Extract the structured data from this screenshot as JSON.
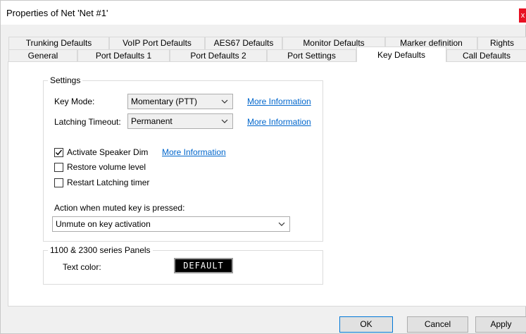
{
  "window": {
    "title": "Properties of Net 'Net #1'",
    "close_glyph": "x"
  },
  "tabs": {
    "back_row": [
      "Trunking Defaults",
      "VoIP Port Defaults",
      "AES67 Defaults",
      "Monitor Defaults",
      "Marker definition",
      "Rights"
    ],
    "front_row": [
      "General",
      "Port Defaults 1",
      "Port Defaults 2",
      "Port Settings",
      "Key Defaults",
      "Call Defaults"
    ],
    "active": "Key Defaults"
  },
  "settings": {
    "legend": "Settings",
    "key_mode_label": "Key Mode:",
    "key_mode_value": "Momentary (PTT)",
    "latching_timeout_label": "Latching Timeout:",
    "latching_timeout_value": "Permanent",
    "more_info_1": "More Information",
    "more_info_2": "More Information",
    "activate_speaker_dim": {
      "label": "Activate Speaker Dim",
      "checked": true
    },
    "more_info_3": "More Information",
    "restore_volume": {
      "label": "Restore volume level",
      "checked": false
    },
    "restart_latching": {
      "label": "Restart Latching timer",
      "checked": false
    },
    "muted_action_label": "Action when muted key is pressed:",
    "muted_action_value": "Unmute on key activation"
  },
  "panels": {
    "legend": "1100 & 2300 series Panels",
    "text_color_label": "Text color:",
    "text_color_value": "DEFAULT"
  },
  "buttons": {
    "ok": "OK",
    "cancel": "Cancel",
    "apply": "Apply"
  },
  "colors": {
    "link": "#0066cc",
    "close_button": "#e81123",
    "default_button_border": "#0078d7"
  },
  "icons": {
    "dropdown": "chevron-down-icon",
    "check": "checkmark-icon"
  }
}
